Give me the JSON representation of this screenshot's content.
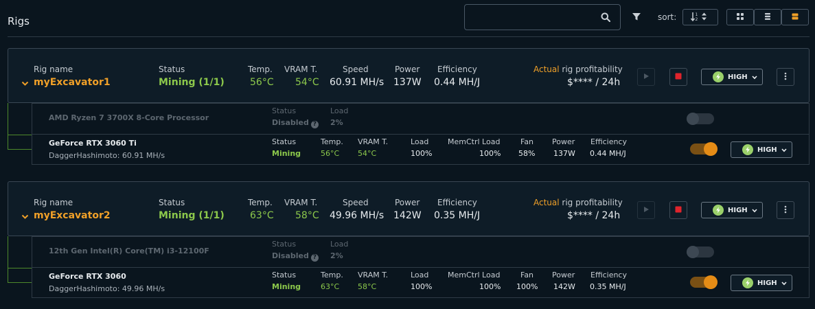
{
  "header": {
    "title": "Rigs",
    "search": {
      "value": "",
      "placeholder": ""
    },
    "sort_label": "sort:",
    "view_modes": [
      "grid-view",
      "list-view",
      "compact-view"
    ]
  },
  "labels": {
    "rig_name": "Rig name",
    "status": "Status",
    "temp": "Temp.",
    "vram_temp": "VRAM T.",
    "speed": "Speed",
    "power": "Power",
    "efficiency": "Efficiency",
    "actual": "Actual",
    "rig_profitability": " rig profitability",
    "load": "Load",
    "memctrl_load": "MemCtrl Load",
    "fan": "Fan",
    "dev_temp": "Temp.",
    "dev_vram": "VRAM T."
  },
  "rigs": [
    {
      "name": "myExcavator1",
      "status": "Mining (1/1)",
      "temp": "56°C",
      "vram_temp": "54°C",
      "speed": "60.91 MH/s",
      "power": "137W",
      "efficiency": "0.44 MH/J",
      "profitability": "$**** / 24h",
      "power_mode": "HIGH",
      "cpu": {
        "name": "AMD Ryzen 7 3700X 8-Core Processor",
        "status": "Disabled",
        "load": "2%",
        "enabled": false
      },
      "gpu": {
        "name": "GeForce RTX 3060 Ti",
        "algo": "DaggerHashimoto: 60.91 MH/s",
        "status": "Mining",
        "temp": "56°C",
        "vram_temp": "54°C",
        "load": "100%",
        "memctrl_load": "100%",
        "fan": "58%",
        "power": "137W",
        "efficiency": "0.44 MH/J",
        "power_mode": "HIGH",
        "enabled": true
      }
    },
    {
      "name": "myExcavator2",
      "status": "Mining (1/1)",
      "temp": "63°C",
      "vram_temp": "58°C",
      "speed": "49.96 MH/s",
      "power": "142W",
      "efficiency": "0.35 MH/J",
      "profitability": "$**** / 24h",
      "power_mode": "HIGH",
      "cpu": {
        "name": "12th Gen Intel(R) Core(TM) i3-12100F",
        "status": "Disabled",
        "load": "2%",
        "enabled": false
      },
      "gpu": {
        "name": "GeForce RTX 3060",
        "algo": "DaggerHashimoto: 49.96 MH/s",
        "status": "Mining",
        "temp": "63°C",
        "vram_temp": "58°C",
        "load": "100%",
        "memctrl_load": "100%",
        "fan": "100%",
        "power": "142W",
        "efficiency": "0.35 MH/J",
        "power_mode": "HIGH",
        "enabled": true
      }
    }
  ],
  "colors": {
    "background": "#0a151e",
    "accent_orange": "#f0a028",
    "status_green": "#8cc84b",
    "stop_red": "#e0242c",
    "bolt_green": "#9ad06a"
  },
  "icons": [
    "search-icon",
    "filter-icon",
    "sort-icon",
    "grid-view-icon",
    "list-view-icon",
    "compact-view-icon",
    "chevron-down-icon",
    "play-icon",
    "stop-icon",
    "bolt-icon",
    "more-icon",
    "help-icon"
  ]
}
